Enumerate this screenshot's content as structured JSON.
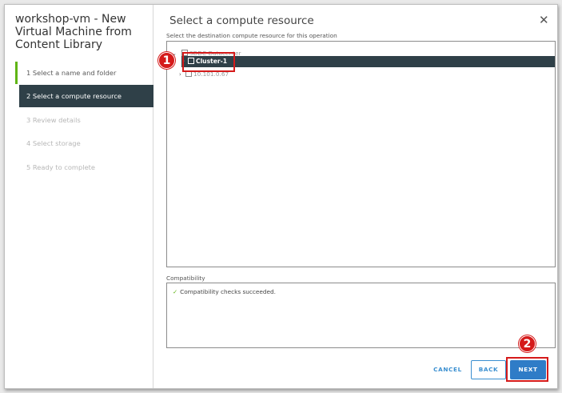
{
  "wizard": {
    "title": "workshop-vm - New Virtual Machine from Content Library",
    "steps": [
      {
        "label": "1  Select a name and folder",
        "state": "done"
      },
      {
        "label": "2  Select a compute resource",
        "state": "active"
      },
      {
        "label": "3  Review details",
        "state": "pending"
      },
      {
        "label": "4  Select storage",
        "state": "pending"
      },
      {
        "label": "5  Ready to complete",
        "state": "pending"
      }
    ]
  },
  "content": {
    "title": "Select a compute resource",
    "subtitle": "Select the destination compute resource for this operation",
    "close_icon": "close-icon"
  },
  "tree": {
    "datacenter": "SDDC-Datacenter",
    "cluster": "Cluster-1",
    "host": "10.101.0.67"
  },
  "compatibility": {
    "label": "Compatibility",
    "message": "Compatibility checks succeeded."
  },
  "callouts": {
    "one": "1",
    "two": "2"
  },
  "buttons": {
    "cancel": "CANCEL",
    "back": "BACK",
    "next": "NEXT"
  },
  "colors": {
    "accent": "#2f7cc7",
    "active_bg": "#2f4048",
    "success": "#60b515",
    "callout": "#d51a1a"
  }
}
